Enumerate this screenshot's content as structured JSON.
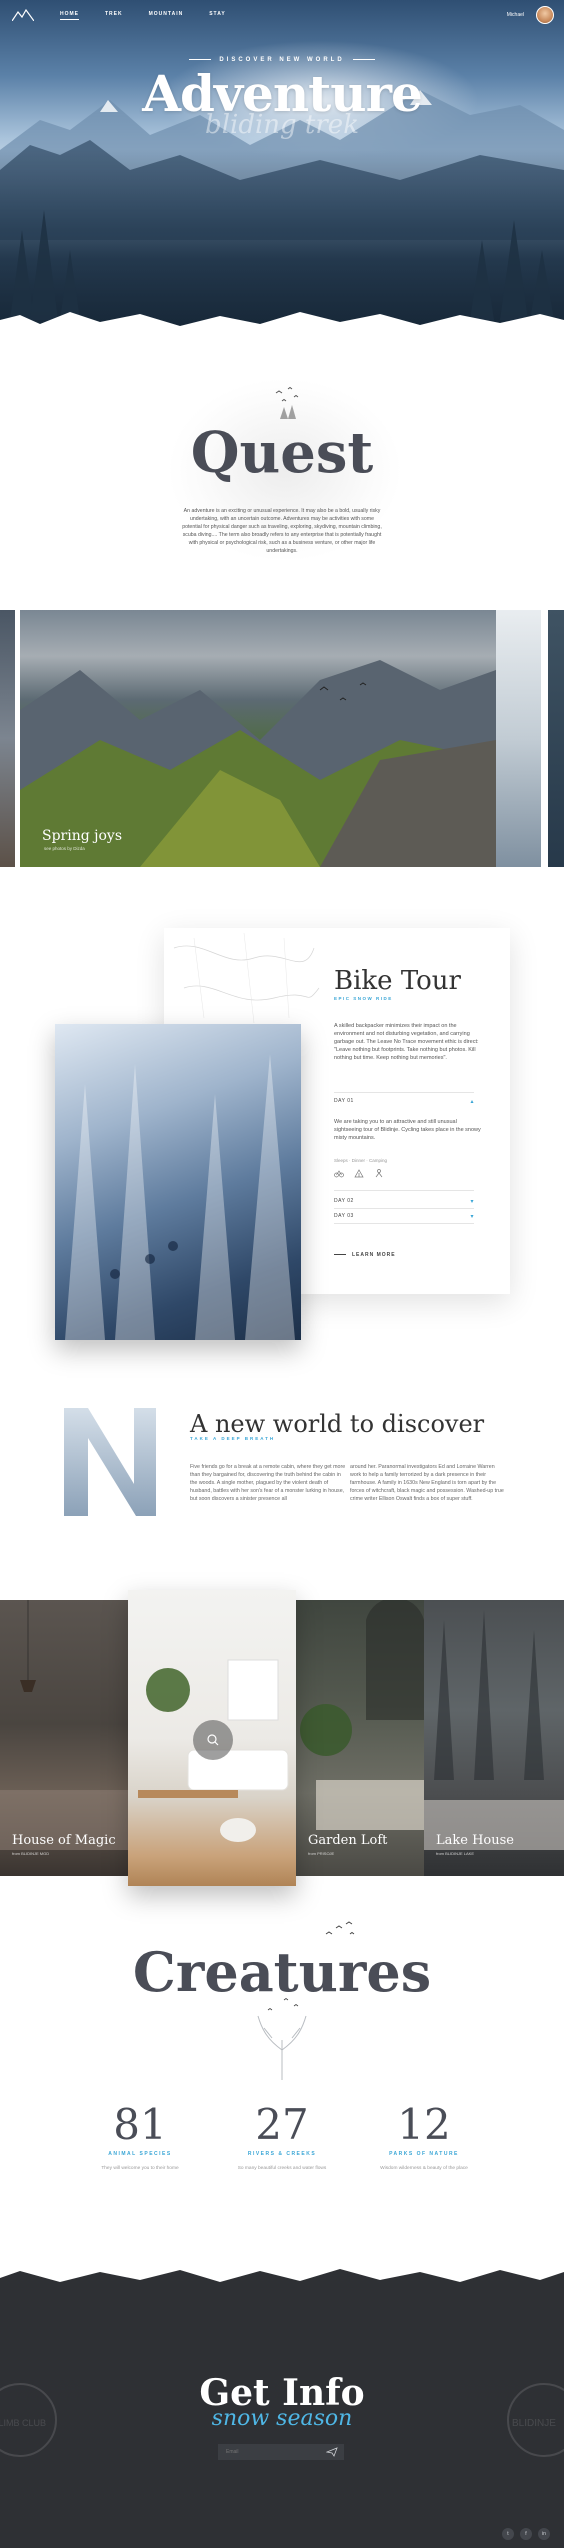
{
  "nav": {
    "links": [
      "HOME",
      "TREK",
      "MOUNTAIN",
      "STAY"
    ],
    "active": "HOME",
    "user_name": "Michael"
  },
  "hero": {
    "kicker": "DISCOVER NEW WORLD",
    "title": "Adventure",
    "script": "bliding trek"
  },
  "quest": {
    "title": "Quest",
    "text": "An adventure is an exciting or unusual experience. It may also be a bold, usually risky undertaking, with an uncertain outcome. Adventures may be activities with some potential for physical danger such as traveling, exploring, skydiving, mountain climbing, scuba diving.... The term also broadly refers to any enterprise that is potentially fraught with physical or psychological risk, such as a business venture, or other major life undertakings."
  },
  "carousel": {
    "active_title": "Spring joys",
    "active_subtitle": "see photos by Dizda"
  },
  "bike_tour": {
    "title": "Bike Tour",
    "tag": "EPIC SNOW RIDE",
    "description": "A skilled backpacker minimizes their impact on the environment and not disturbing vegetation, and carrying garbage out. The Leave No Trace movement ethic is direct: \"Leave nothing but footprints. Take nothing but photos. Kill nothing but time. Keep nothing but memories\".",
    "days": [
      {
        "label": "DAY 01",
        "expanded": true
      },
      {
        "label": "DAY 02",
        "expanded": false
      },
      {
        "label": "DAY 03",
        "expanded": false
      }
    ],
    "day_text": "We are taking you to an attractive and still unusual sightseeing tour of Blidinje. Cycling takes place in the snowy misty mountains.",
    "meta": "Sleeps · Dinner · Camping",
    "icons": [
      "bike-icon",
      "tent-icon",
      "person-icon"
    ],
    "learn_more": "LEARN MORE"
  },
  "new_world": {
    "letter": "N",
    "title": "A new world to discover",
    "tag": "TAKE A DEEP BREATH",
    "col1": "Five friends go for a break at a remote cabin, where they get more than they bargained for, discovering the truth behind the cabin in the woods. A single mother, plagued by the violent death of husband, battles with her son's fear of a monster lurking in house, but soon discovers a sinister presence all",
    "col2": "around her. Paranormal investigators Ed and Lorraine Warren work to help a family terrorized by a dark presence in their farmhouse. A family in 1630s New England is torn apart by the forces of witchcraft, black magic and possession. Washed-up true crime writer Ellison Oswalt finds a box of super stuff."
  },
  "rooms": [
    {
      "name": "House of Magic",
      "sub": "from BLIDINJE MGD"
    },
    {
      "name": "",
      "sub": ""
    },
    {
      "name": "Garden Loft",
      "sub": "from PRISOJE"
    },
    {
      "name": "Lake House",
      "sub": "from BLIDINJE LAKE"
    }
  ],
  "creatures": {
    "title": "Creatures",
    "stats": [
      {
        "value": "81",
        "label": "ANIMAL SPECIES",
        "desc": "They will welcome you to their home"
      },
      {
        "value": "27",
        "label": "RIVERS & CREEKS",
        "desc": "So many beautiful creeks and water flows"
      },
      {
        "value": "12",
        "label": "PARKS OF NATURE",
        "desc": "Wisdom wilderness & beauty of the place"
      }
    ]
  },
  "footer": {
    "title": "Get Info",
    "script": "snow season",
    "email_placeholder": "Email",
    "emblem_left": "CLIMB CLUB",
    "emblem_right": "BLIDINJE",
    "social": [
      "t",
      "f",
      "in"
    ]
  },
  "colors": {
    "accent": "#3aa6d6",
    "heading": "#4a4d57",
    "footer_bg": "#2e3034"
  }
}
